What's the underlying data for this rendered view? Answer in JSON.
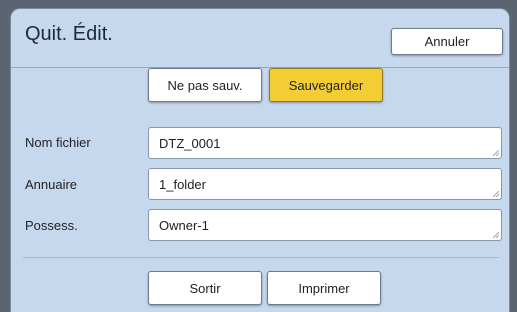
{
  "dialog": {
    "title": "Quit. Édit.",
    "cancel_label": "Annuler",
    "no_save_label": "Ne pas sauv.",
    "save_label": "Sauvegarder",
    "exit_label": "Sortir",
    "print_label": "Imprimer"
  },
  "fields": {
    "file_name": {
      "label": "Nom fichier",
      "value": "DTZ_0001"
    },
    "directory": {
      "label": "Annuaire",
      "value": "1_folder"
    },
    "owner": {
      "label": "Possess.",
      "value": "Owner-1"
    }
  },
  "colors": {
    "dialog_bg": "#c6d8ee",
    "save_accent": "#f4cd34"
  }
}
